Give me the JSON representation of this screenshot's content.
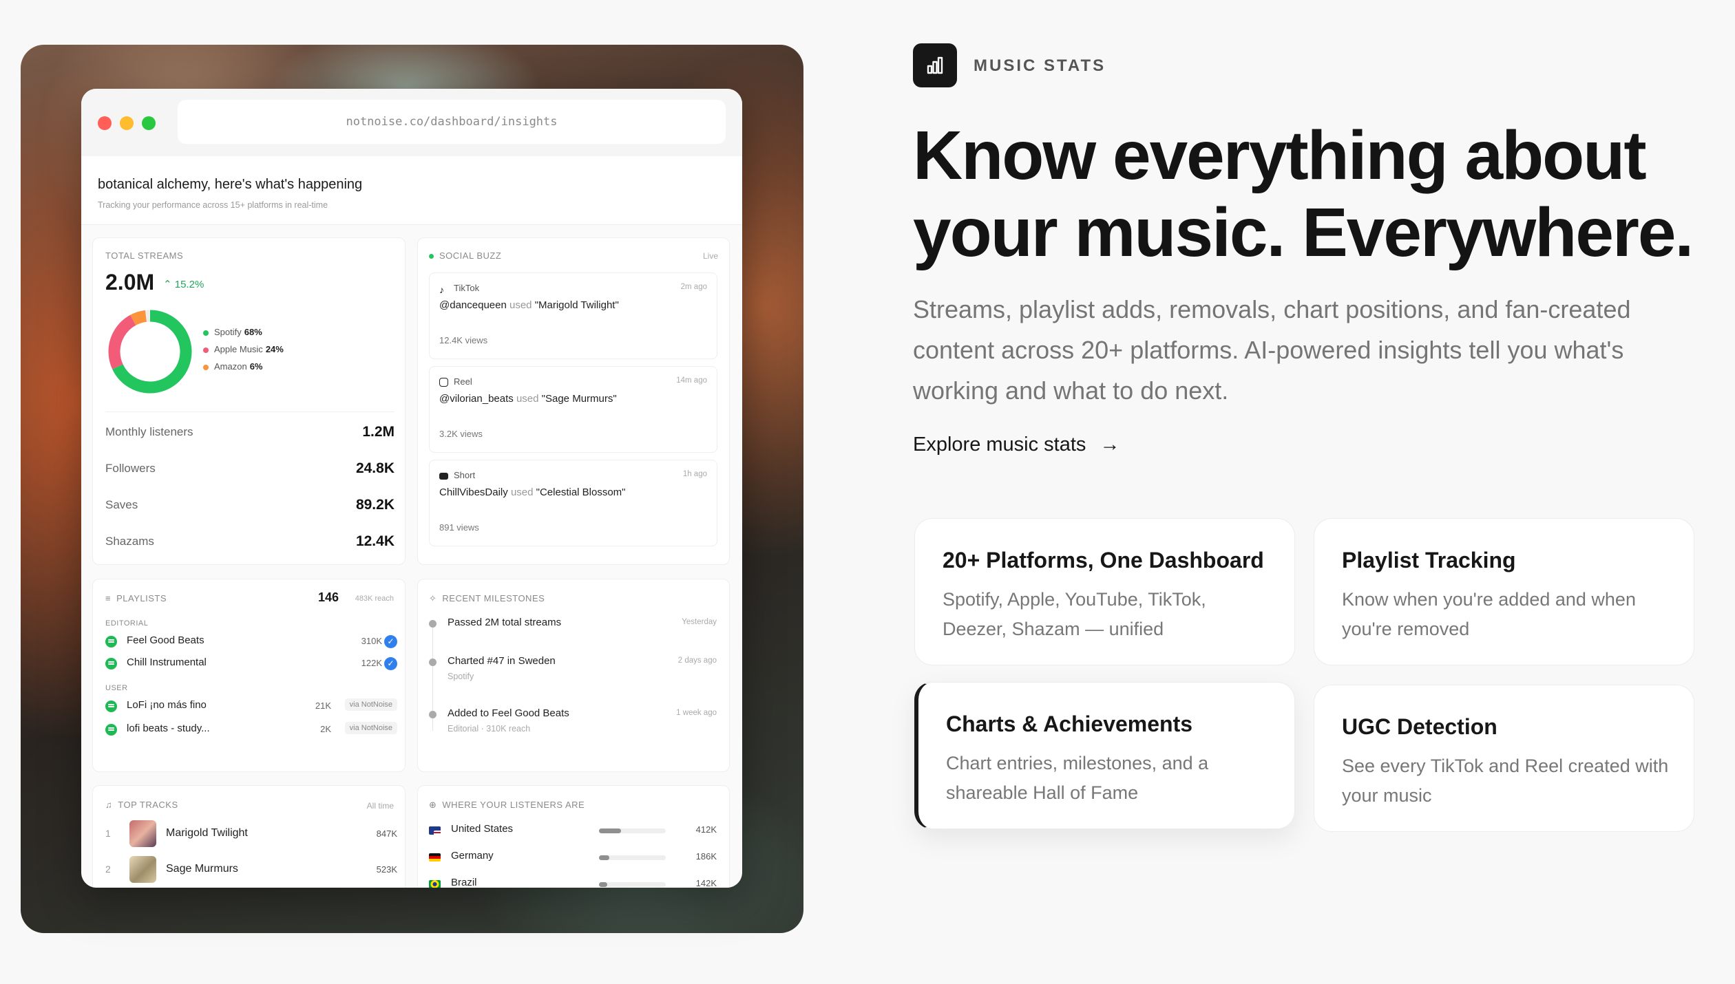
{
  "browser": {
    "url": "notnoise.co/dashboard/insights"
  },
  "dashboard": {
    "title": "botanical alchemy, here's what's happening",
    "subtitle": "Tracking your performance across 15+ platforms in real-time"
  },
  "streams": {
    "label": "TOTAL STREAMS",
    "value": "2.0M",
    "change": "15.2%",
    "breakdown": [
      {
        "name": "Spotify",
        "pct": "68%",
        "share": 68,
        "color": "#22c55e"
      },
      {
        "name": "Apple Music",
        "pct": "24%",
        "share": 24,
        "color": "#f25c78"
      },
      {
        "name": "Amazon",
        "pct": "6%",
        "share": 6,
        "color": "#fb923c"
      }
    ],
    "stats": [
      {
        "label": "Monthly listeners",
        "value": "1.2M"
      },
      {
        "label": "Followers",
        "value": "24.8K"
      },
      {
        "label": "Saves",
        "value": "89.2K"
      },
      {
        "label": "Shazams",
        "value": "12.4K"
      }
    ]
  },
  "social": {
    "label": "SOCIAL BUZZ",
    "live": "Live",
    "used_word": "used",
    "posts": [
      {
        "platform": "TikTok",
        "time": "2m ago",
        "user": "@dancequeen",
        "track": "\"Marigold Twilight\"",
        "views": "12.4K views"
      },
      {
        "platform": "Reel",
        "time": "14m ago",
        "user": "@vilorian_beats",
        "track": "\"Sage Murmurs\"",
        "views": "3.2K views"
      },
      {
        "platform": "Short",
        "time": "1h ago",
        "user": "ChillVibesDaily",
        "track": "\"Celestial Blossom\"",
        "views": "891 views"
      }
    ]
  },
  "playlists": {
    "label": "PLAYLISTS",
    "count": "146",
    "reach": "483K reach",
    "editorial_label": "EDITORIAL",
    "user_label": "USER",
    "editorial": [
      {
        "name": "Feel Good Beats",
        "count": "310K"
      },
      {
        "name": "Chill Instrumental",
        "count": "122K"
      }
    ],
    "user": [
      {
        "name": "LoFi ¡no más fino",
        "count": "21K",
        "via": "via NotNoise"
      },
      {
        "name": "lofi beats - study...",
        "count": "2K",
        "via": "via NotNoise"
      }
    ]
  },
  "milestones": {
    "label": "RECENT MILESTONES",
    "items": [
      {
        "title": "Passed 2M total streams",
        "sub": "",
        "date": "Yesterday"
      },
      {
        "title": "Charted #47 in Sweden",
        "sub": "Spotify",
        "date": "2 days ago"
      },
      {
        "title": "Added to Feel Good Beats",
        "sub": "Editorial · 310K reach",
        "date": "1 week ago"
      }
    ]
  },
  "tracks": {
    "label": "TOP TRACKS",
    "range": "All time",
    "items": [
      {
        "rank": "1",
        "name": "Marigold Twilight",
        "count": "847K"
      },
      {
        "rank": "2",
        "name": "Sage Murmurs",
        "count": "523K"
      }
    ]
  },
  "locations": {
    "label": "WHERE YOUR LISTENERS ARE",
    "items": [
      {
        "country": "United States",
        "count": "412K",
        "share": 0.33
      },
      {
        "country": "Germany",
        "count": "186K",
        "share": 0.15
      },
      {
        "country": "Brazil",
        "count": "142K",
        "share": 0.12
      }
    ]
  },
  "hero": {
    "eyebrow": "MUSIC STATS",
    "headline_line1": "Know everything about",
    "headline_line2": "your music. Everywhere.",
    "lede": "Streams, playlist adds, removals, chart positions, and fan-created content across 20+ platforms. AI-powered insights tell you what's working and what to do next.",
    "cta": "Explore music stats"
  },
  "features": [
    {
      "title": "20+ Platforms, One Dashboard",
      "desc": "Spotify, Apple, YouTube, TikTok, Deezer, Shazam — unified"
    },
    {
      "title": "Playlist Tracking",
      "desc": "Know when you're added and when you're removed"
    },
    {
      "title": "Charts & Achievements",
      "desc": "Chart entries, milestones, and a shareable Hall of Fame"
    },
    {
      "title": "UGC Detection",
      "desc": "See every TikTok and Reel created with your music"
    }
  ],
  "colors": {
    "accent": "#22c55e",
    "dark": "#171717",
    "verified": "#2f80ed"
  }
}
